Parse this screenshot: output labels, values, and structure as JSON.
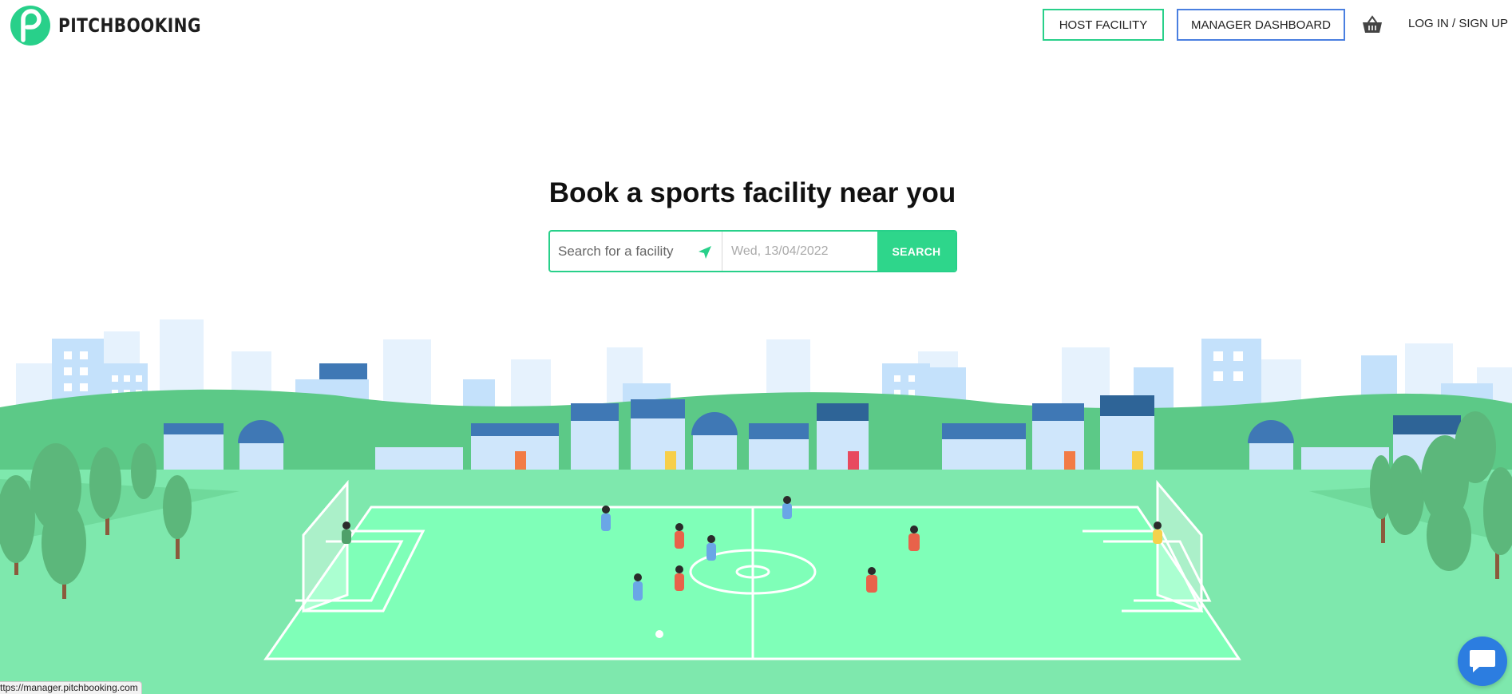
{
  "header": {
    "brand": "PITCHBOOKING",
    "host_facility_label": "HOST FACILITY",
    "manager_dashboard_label": "MANAGER DASHBOARD",
    "cart_icon": "basket-icon",
    "login_label": "LOG IN / SIGN UP"
  },
  "hero": {
    "title": "Book a sports facility near you",
    "search": {
      "placeholder": "Search for a facility",
      "location_icon": "location-arrow-icon",
      "date_value": "Wed, 13/04/2022",
      "button_label": "SEARCH"
    }
  },
  "status_bar": {
    "url": "ttps://manager.pitchbooking.com"
  },
  "chat": {
    "icon": "chat-bubble-icon"
  },
  "colors": {
    "brand_green": "#2ed68b",
    "manager_blue": "#4a7fe0",
    "pitch_green": "#7fffb8",
    "grass_green": "#7ee8ad",
    "chat_blue": "#2c7de0"
  }
}
